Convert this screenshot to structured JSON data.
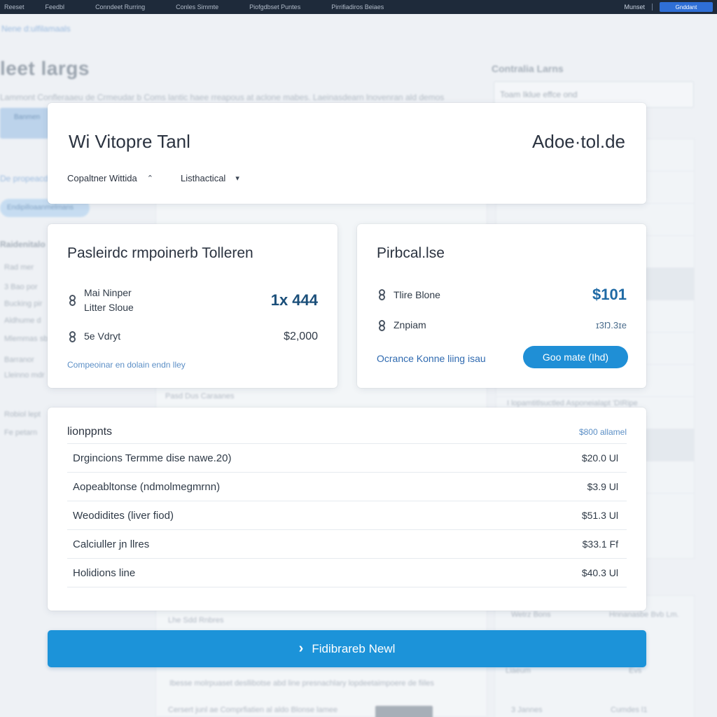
{
  "nav": {
    "items": [
      "Reeset",
      "Feedbl",
      "Conndeet Rurring",
      "Conles Simmte",
      "Piofgdbset Puntes",
      "Pirrifiadiros Beiaes"
    ],
    "right_label": "Munset",
    "button_label": "Gnddant"
  },
  "background": {
    "breadcrumb": "Nene d:ulfilamaals",
    "heading": "leet largs",
    "description": "Lammont Confleraaeu de Crmeudar b Coms lantic haee rreapous at aclone mabes. Laeinasdearn lnovenran ald demos",
    "side_title": "Contralia Larns",
    "side_input": "Toam Iklue effce ond",
    "pill": "Banmen",
    "link": "De propeacdl",
    "pill2": "Endipilloaanmelmans",
    "filters_title": "Raidenitalo",
    "filters": [
      "Rad mer",
      "3 Bao por",
      "Bucking pir",
      "Aldhume d",
      "Mlemmas sb",
      "Barranor",
      "Lleinno mdr",
      "Robiol lept",
      "Fe petarn"
    ],
    "foot_texts": [
      "Pasd Dus Caraanes",
      "Lhe Sdd Rnbres",
      "Ibesse molrpuaset desllibotse abd line presnachlary lopdeetaimpoere de fiiles",
      "Cersert junl ae Comprfiatien al aldo Blonse lamee",
      "I lopamtitlsuctled Asponeialapt 'DIRipe",
      "Wetrz Bons",
      "Hnnanasbe Bvb Lm.",
      "Liaeum",
      "Evs",
      "3 Jannes",
      "Cumdes l1"
    ]
  },
  "header": {
    "title": "Wi Vitopre Tanl",
    "brand": "Adoe·tol.de",
    "dropdown1": "Copaltner Wittida",
    "dropdown2": "Listhactical"
  },
  "left_card": {
    "title": "Pasleirdc rmpoinerb Tolleren",
    "item1_line1": "Mai Ninper",
    "item1_line2": "Litter Sloue",
    "item1_value": "1x 444",
    "item2_label": "5e Vdryt",
    "item2_value": "$2,000",
    "footnote": "Compeoinar en dolain endn lley"
  },
  "right_card": {
    "title": "Pirbcal.lse",
    "item1_label": "Tlire Blone",
    "item1_value": "$101",
    "item2_label": "Znpiam",
    "item2_value": "ɪ3Ŋ.3ɪe",
    "promo_text": "Ocrance Konne liing isau",
    "button_label": "Goo mate (Ihd)"
  },
  "table": {
    "header_left": "lionppnts",
    "header_right": "$800 allamel",
    "rows": [
      {
        "name": "Drgincions Termme dise nawe.20)",
        "price": "$20.0 Ul"
      },
      {
        "name": "Aopeabltonse (ndmolmegmrnn)",
        "price": "$3.9 Ul"
      },
      {
        "name": "Weodidites (liver fiod)",
        "price": "$51.3 Ul"
      },
      {
        "name": "Calciuller jn llres",
        "price": "$33.1 Ff"
      },
      {
        "name": "Holidions line",
        "price": "$40.3 Ul"
      }
    ]
  },
  "cta": {
    "label": "Fidibrareb Newl"
  },
  "colors": {
    "accent": "#1c93d9",
    "nav_bg": "#1e2a3a",
    "link": "#5c8fc6"
  }
}
